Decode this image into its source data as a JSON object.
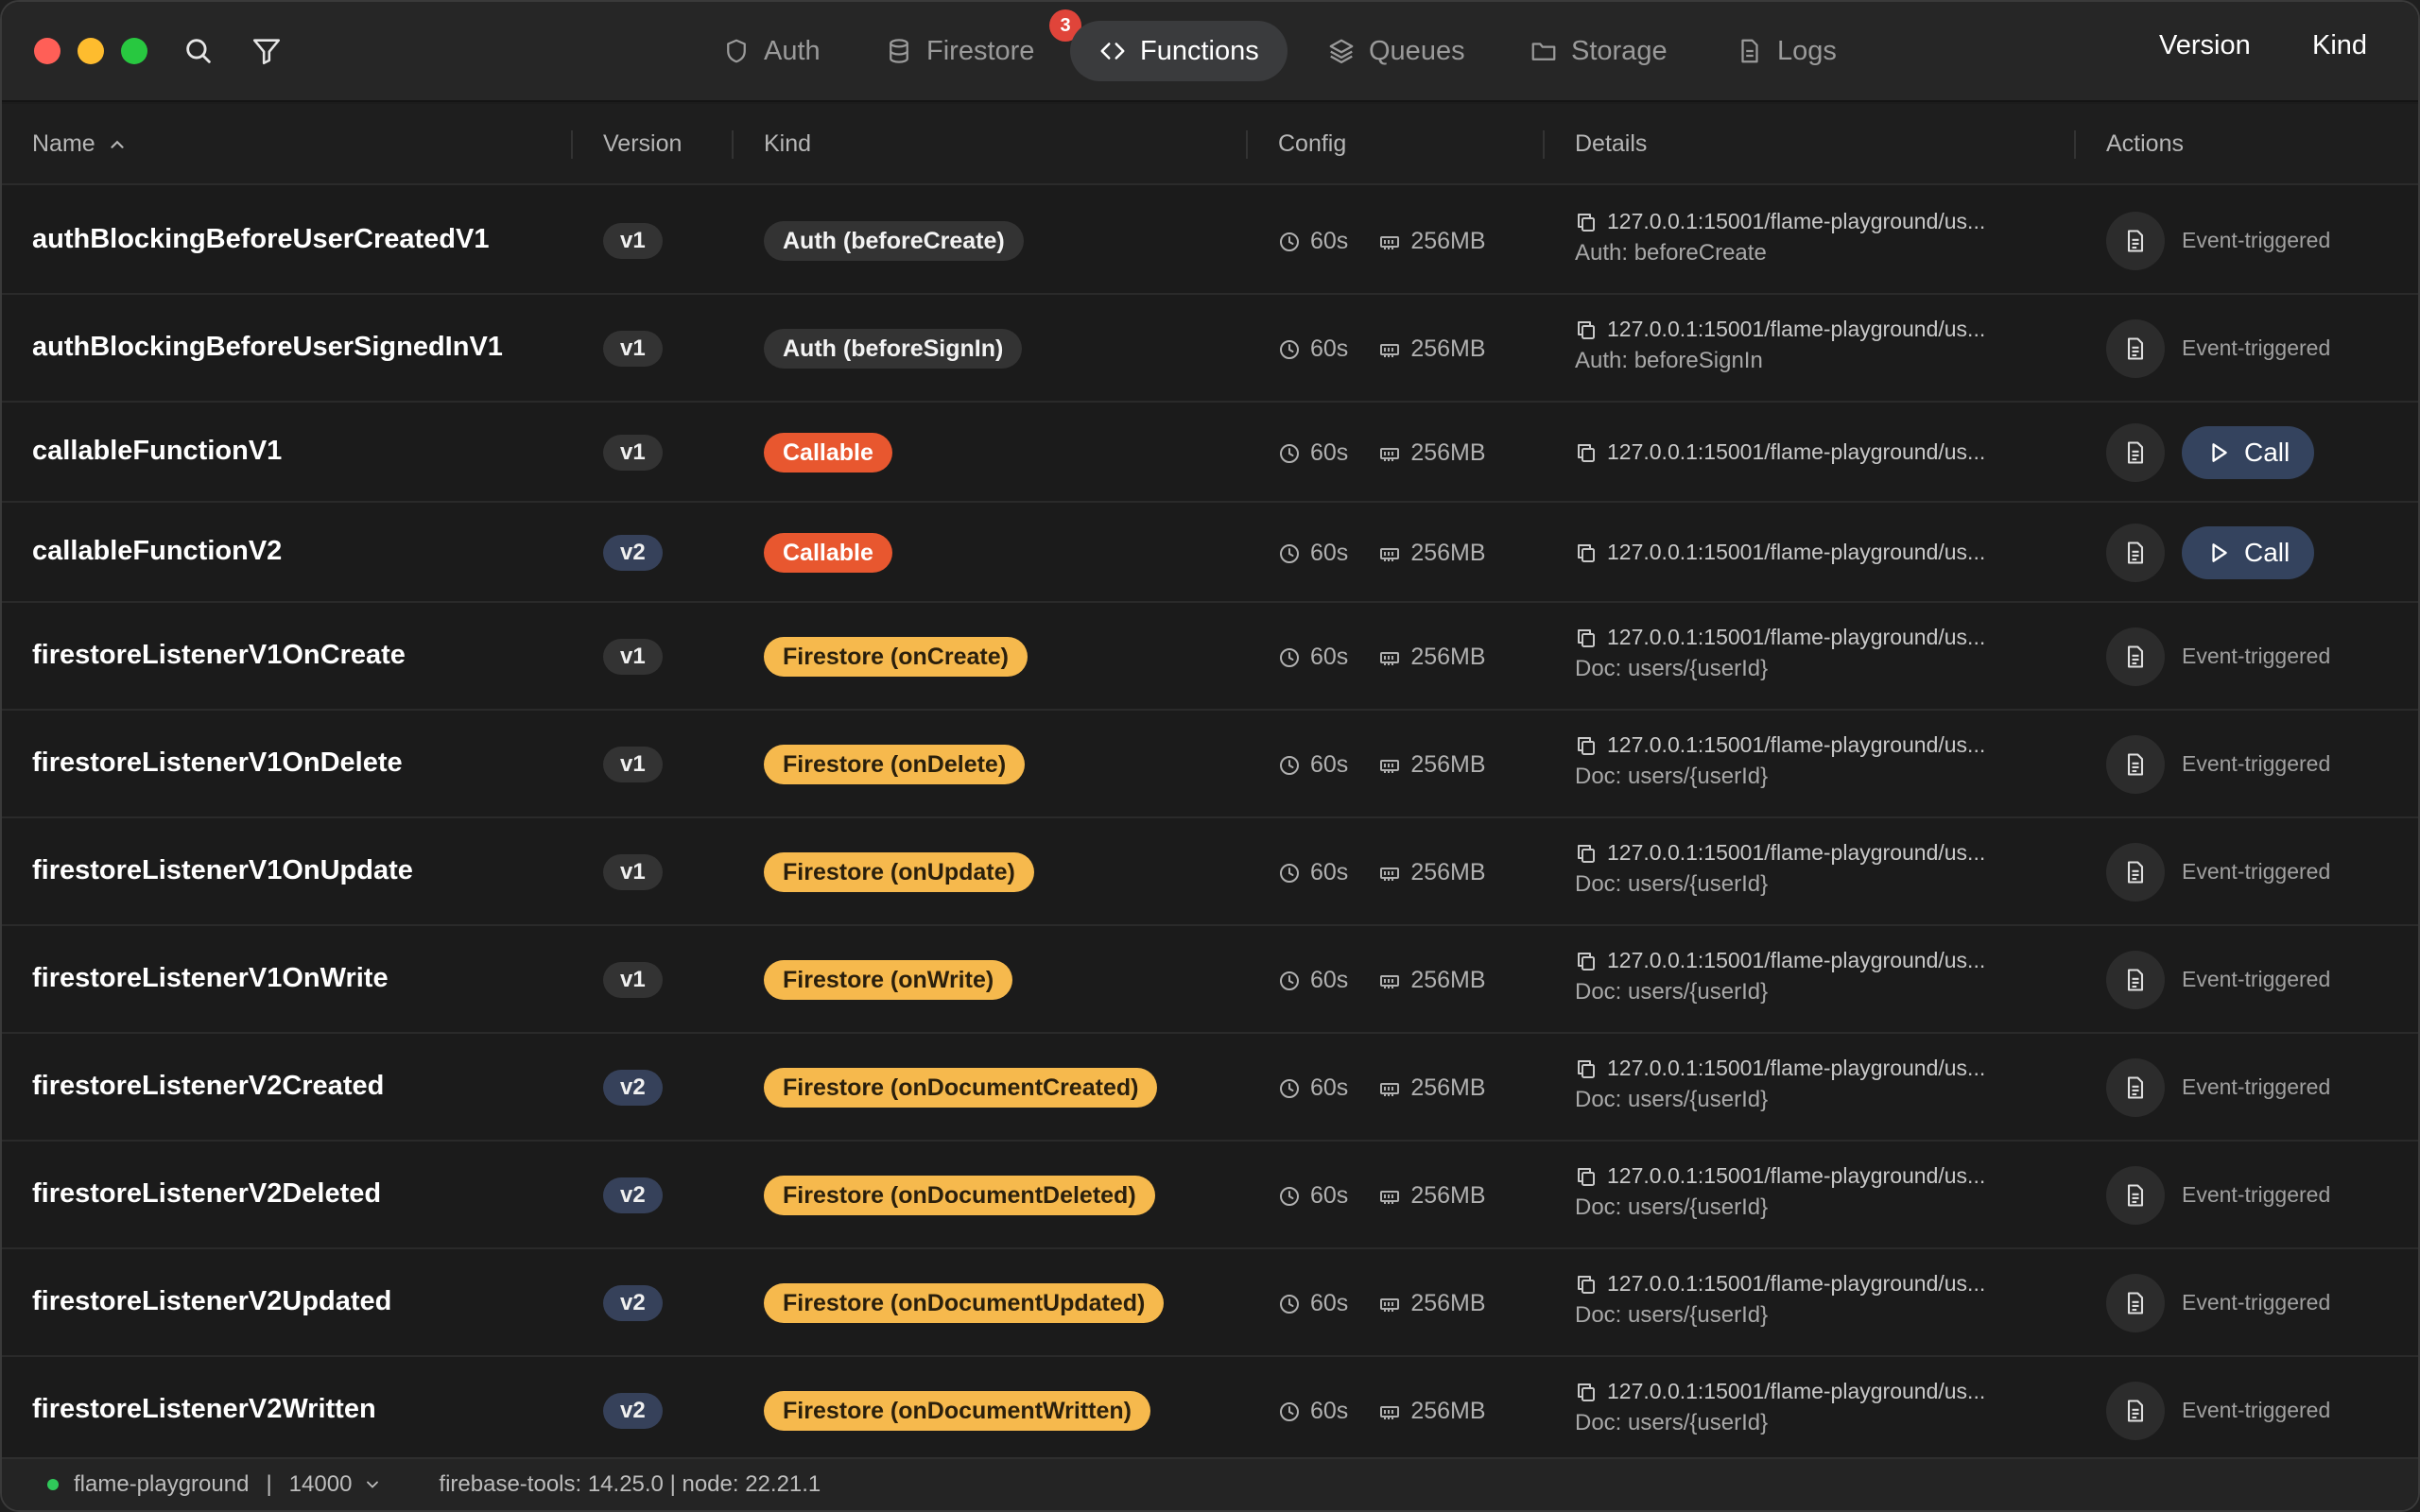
{
  "toolbar": {
    "search_icon": "search-icon",
    "filter_icon": "filter-icon"
  },
  "tabs": [
    {
      "label": "Auth",
      "icon": "shield-icon"
    },
    {
      "label": "Firestore",
      "icon": "database-icon",
      "badge": "3"
    },
    {
      "label": "Functions",
      "icon": "code-icon",
      "active": true
    },
    {
      "label": "Queues",
      "icon": "layers-icon"
    },
    {
      "label": "Storage",
      "icon": "folder-icon"
    },
    {
      "label": "Logs",
      "icon": "file-icon"
    }
  ],
  "right_controls": {
    "version": "Version",
    "kind": "Kind"
  },
  "columns": {
    "name": "Name",
    "version": "Version",
    "kind": "Kind",
    "config": "Config",
    "details": "Details",
    "actions": "Actions"
  },
  "rows": [
    {
      "name": "authBlockingBeforeUserCreatedV1",
      "version": "v1",
      "kind": "Auth (beforeCreate)",
      "kind_type": "auth",
      "timeout": "60s",
      "memory": "256MB",
      "url": "127.0.0.1:15001/flame-playground/us...",
      "detail": "Auth: beforeCreate",
      "action": "Event-triggered"
    },
    {
      "name": "authBlockingBeforeUserSignedInV1",
      "version": "v1",
      "kind": "Auth (beforeSignIn)",
      "kind_type": "auth",
      "timeout": "60s",
      "memory": "256MB",
      "url": "127.0.0.1:15001/flame-playground/us...",
      "detail": "Auth: beforeSignIn",
      "action": "Event-triggered"
    },
    {
      "name": "callableFunctionV1",
      "version": "v1",
      "kind": "Callable",
      "kind_type": "callable",
      "timeout": "60s",
      "memory": "256MB",
      "url": "127.0.0.1:15001/flame-playground/us...",
      "detail": "",
      "action": "Call"
    },
    {
      "name": "callableFunctionV2",
      "version": "v2",
      "kind": "Callable",
      "kind_type": "callable",
      "timeout": "60s",
      "memory": "256MB",
      "url": "127.0.0.1:15001/flame-playground/us...",
      "detail": "",
      "action": "Call"
    },
    {
      "name": "firestoreListenerV1OnCreate",
      "version": "v1",
      "kind": "Firestore (onCreate)",
      "kind_type": "firestore",
      "timeout": "60s",
      "memory": "256MB",
      "url": "127.0.0.1:15001/flame-playground/us...",
      "detail": "Doc: users/{userId}",
      "action": "Event-triggered"
    },
    {
      "name": "firestoreListenerV1OnDelete",
      "version": "v1",
      "kind": "Firestore (onDelete)",
      "kind_type": "firestore",
      "timeout": "60s",
      "memory": "256MB",
      "url": "127.0.0.1:15001/flame-playground/us...",
      "detail": "Doc: users/{userId}",
      "action": "Event-triggered"
    },
    {
      "name": "firestoreListenerV1OnUpdate",
      "version": "v1",
      "kind": "Firestore (onUpdate)",
      "kind_type": "firestore",
      "timeout": "60s",
      "memory": "256MB",
      "url": "127.0.0.1:15001/flame-playground/us...",
      "detail": "Doc: users/{userId}",
      "action": "Event-triggered"
    },
    {
      "name": "firestoreListenerV1OnWrite",
      "version": "v1",
      "kind": "Firestore (onWrite)",
      "kind_type": "firestore",
      "timeout": "60s",
      "memory": "256MB",
      "url": "127.0.0.1:15001/flame-playground/us...",
      "detail": "Doc: users/{userId}",
      "action": "Event-triggered"
    },
    {
      "name": "firestoreListenerV2Created",
      "version": "v2",
      "kind": "Firestore (onDocumentCreated)",
      "kind_type": "firestore",
      "timeout": "60s",
      "memory": "256MB",
      "url": "127.0.0.1:15001/flame-playground/us...",
      "detail": "Doc: users/{userId}",
      "action": "Event-triggered"
    },
    {
      "name": "firestoreListenerV2Deleted",
      "version": "v2",
      "kind": "Firestore (onDocumentDeleted)",
      "kind_type": "firestore",
      "timeout": "60s",
      "memory": "256MB",
      "url": "127.0.0.1:15001/flame-playground/us...",
      "detail": "Doc: users/{userId}",
      "action": "Event-triggered"
    },
    {
      "name": "firestoreListenerV2Updated",
      "version": "v2",
      "kind": "Firestore (onDocumentUpdated)",
      "kind_type": "firestore",
      "timeout": "60s",
      "memory": "256MB",
      "url": "127.0.0.1:15001/flame-playground/us...",
      "detail": "Doc: users/{userId}",
      "action": "Event-triggered"
    },
    {
      "name": "firestoreListenerV2Written",
      "version": "v2",
      "kind": "Firestore (onDocumentWritten)",
      "kind_type": "firestore",
      "timeout": "60s",
      "memory": "256MB",
      "url": "127.0.0.1:15001/flame-playground/us...",
      "detail": "Doc: users/{userId}",
      "action": "Event-triggered"
    }
  ],
  "status_bar": {
    "project": "flame-playground",
    "separator": "|",
    "port": "14000",
    "tools": "firebase-tools: 14.25.0 | node: 22.21.1"
  },
  "colors": {
    "callable": "#e8572f",
    "firestore": "#f6b94d",
    "auth": "#333333",
    "active_tab": "#3a3b3d",
    "badge": "#e0443a",
    "call_button": "#34435e"
  }
}
